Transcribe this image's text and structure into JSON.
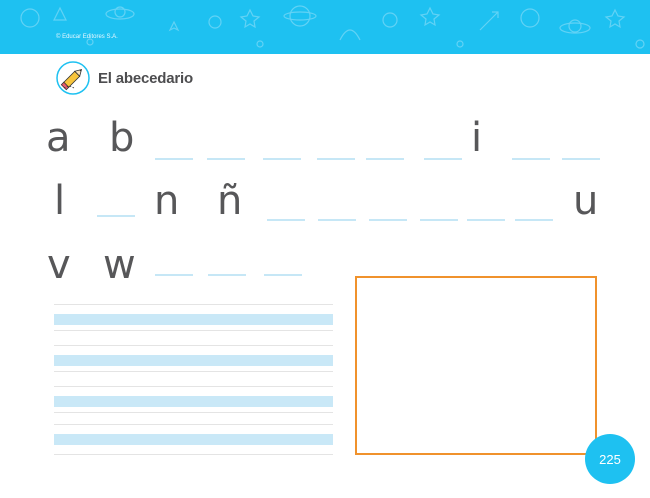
{
  "header": {
    "copyright": "© Educar Editores S.A.",
    "banner_color": "#1ec1f1"
  },
  "title": {
    "icon": "pencil-icon",
    "text": "El abecedario"
  },
  "alphabet": {
    "row1": {
      "given": [
        "a",
        "b",
        "i"
      ],
      "blanks_before_i": 6,
      "blanks_after_i": 2
    },
    "row2": {
      "given": [
        "l",
        "n",
        "ñ",
        "u"
      ],
      "blanks_after_l": 1,
      "blanks_after_ñ": 6
    },
    "row3": {
      "given": [
        "v",
        "w"
      ],
      "blanks_after_w": 3
    }
  },
  "writing_lines": {
    "count": 4,
    "band_color": "#c9e8f7"
  },
  "drawing_box": {
    "border_color": "#f0922c"
  },
  "page": {
    "number": "225"
  }
}
